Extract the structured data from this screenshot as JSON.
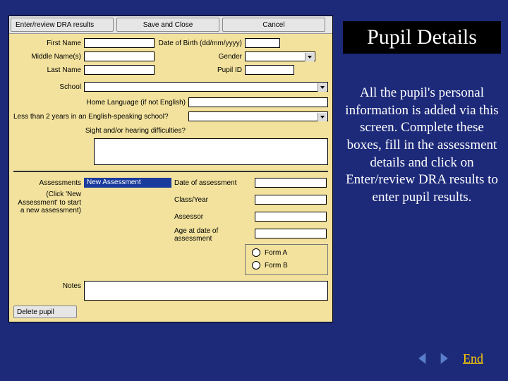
{
  "side": {
    "title": "Pupil Details",
    "body": "All the pupil's personal information is added via this screen.  Complete these boxes, fill in the assessment details and click on Enter/review DRA results to enter pupil results."
  },
  "toolbar": {
    "enter_review": "Enter/review DRA results",
    "save_close": "Save and Close",
    "cancel": "Cancel"
  },
  "labels": {
    "first_name": "First Name",
    "middle_names": "Middle Name(s)",
    "last_name": "Last Name",
    "dob": "Date of Birth (dd/mm/yyyy)",
    "gender": "Gender",
    "pupil_id": "Pupil ID",
    "school": "School",
    "home_lang": "Home Language (if not English)",
    "lt2y": "Less than 2 years in an English-speaking school?",
    "sight": "Sight and/or hearing difficulties?",
    "assessments": "Assessments",
    "click_hint": "(Click 'New Assessment' to start a new assessment)",
    "date_assess": "Date of assessment",
    "class_year": "Class/Year",
    "assessor": "Assessor",
    "age_at": "Age at date of assessment",
    "form_a": "Form A",
    "form_b": "Form B",
    "notes": "Notes",
    "delete_pupil": "Delete pupil",
    "new_assessment_item": "New Assessment"
  },
  "values": {
    "first_name": "",
    "middle_names": "",
    "last_name": "",
    "dob": "",
    "gender": "",
    "pupil_id": "",
    "school": "",
    "home_lang": "",
    "lt2y": "",
    "sight": "",
    "date_assess": "",
    "class_year": "",
    "assessor": "",
    "age_at": "",
    "notes": ""
  },
  "nav": {
    "end": "End"
  }
}
